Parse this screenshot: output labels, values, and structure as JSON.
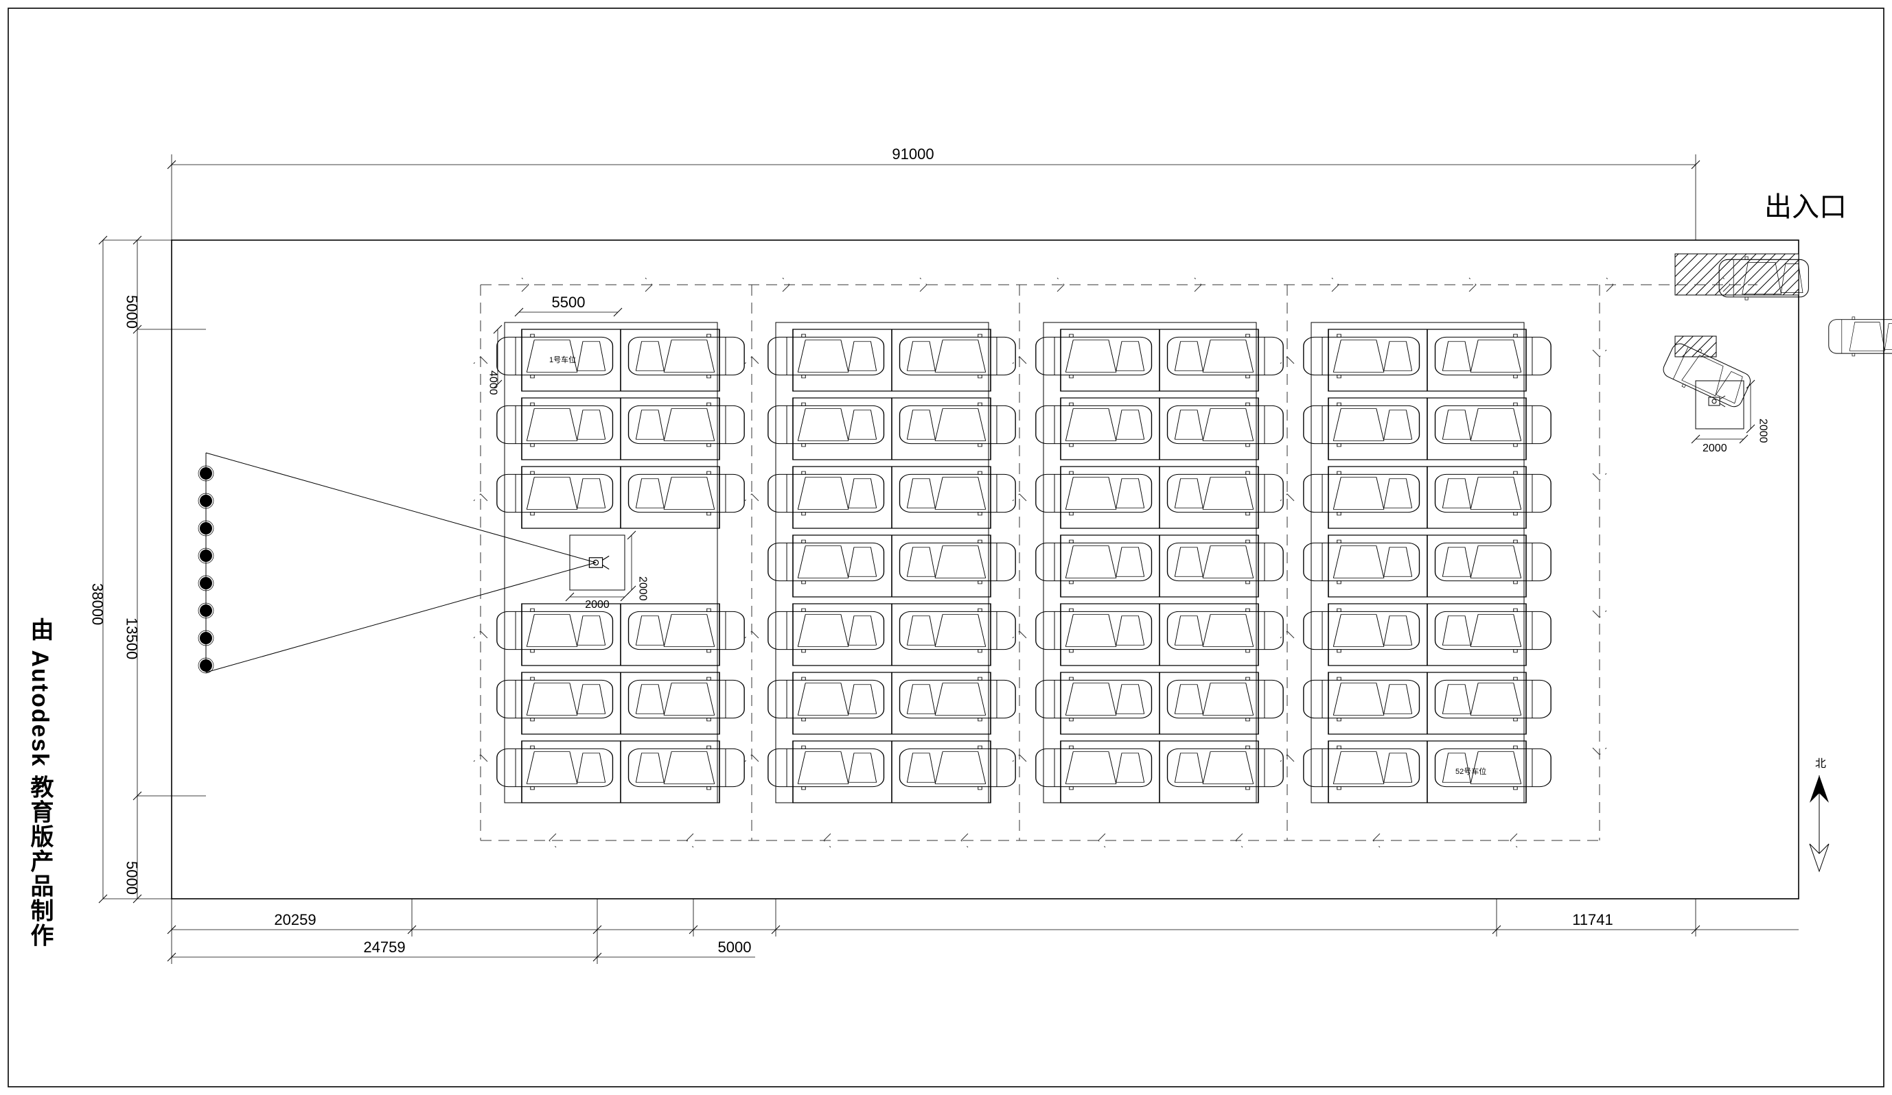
{
  "watermark_text": "由 Autodesk 教育版产品制作",
  "entrance_label": "出入口",
  "compass_label": "北",
  "car_label_first": "1号车位",
  "car_label_last": "52号车位",
  "dimensions": {
    "overall_width": "91000",
    "overall_height_left_bottom": "5000",
    "overall_height_left_top": "5000",
    "overall_height_center": "13500",
    "overall_height_full": "38000",
    "row_stall_inner": "5500",
    "row_stall_depth_small": "4000",
    "camera_box_w": "2000",
    "camera_box_h": "2000",
    "booth_box_w": "2000",
    "booth_box_h": "2000",
    "bottom_seg1": "20259",
    "bottom_seg2": "24759",
    "bottom_seg3": "5000",
    "bottom_seg4": "11741"
  }
}
